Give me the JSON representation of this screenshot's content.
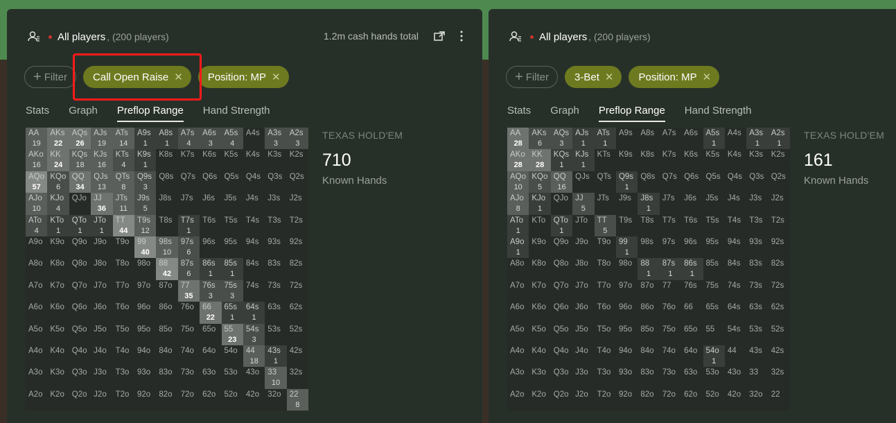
{
  "panels": [
    {
      "header": {
        "label": "All players",
        "count": ", (200 players)",
        "total": "1.2m cash hands total"
      },
      "filter_label": "Filter",
      "chips": [
        "Call Open Raise",
        "Position: MP"
      ],
      "tabs": [
        "Stats",
        "Graph",
        "Preflop Range",
        "Hand Strength"
      ],
      "active_tab": 2,
      "game": "TEXAS HOLD'EM",
      "known_count": "710",
      "known_label": "Known Hands",
      "cells": {
        "AA": 19,
        "AKs": 22,
        "AQs": 26,
        "AJs": 19,
        "ATs": 14,
        "A9s": 1,
        "A8s": 1,
        "A7s": 4,
        "A6s": 3,
        "A5s": 4,
        "A3s": 3,
        "A2s": 3,
        "AKo": 16,
        "KK": 24,
        "KQs": 18,
        "KJs": 16,
        "KTs": 4,
        "K9s": 1,
        "AQo": 57,
        "KQo": 6,
        "QQ": 34,
        "QJs": 13,
        "QTs": 8,
        "Q9s": 3,
        "AJo": 10,
        "KJo": 4,
        "JJ": 36,
        "JTs": 11,
        "J9s": 5,
        "ATo": 4,
        "KTo": 1,
        "QTo": 1,
        "JTo": 1,
        "TT": 44,
        "T9s": 12,
        "T7s": 1,
        "99": 40,
        "98s": 10,
        "97s": 6,
        "88": 42,
        "87s": 6,
        "86s": 1,
        "85s": 1,
        "77": 35,
        "76s": 3,
        "75s": 3,
        "66": 22,
        "65s": 1,
        "64s": 1,
        "55": 23,
        "54s": 3,
        "44": 18,
        "43s": 1,
        "33": 10,
        "22": 8
      }
    },
    {
      "header": {
        "label": "All players",
        "count": ", (200 players)",
        "total": ""
      },
      "filter_label": "Filter",
      "chips": [
        "3-Bet",
        "Position: MP"
      ],
      "tabs": [
        "Stats",
        "Graph",
        "Preflop Range",
        "Hand Strength"
      ],
      "active_tab": 2,
      "game": "TEXAS HOLD'EM",
      "known_count": "161",
      "known_label": "Known Hands",
      "cells": {
        "AA": 28,
        "AKs": 6,
        "AQs": 3,
        "AJs": 1,
        "ATs": 1,
        "A5s": 1,
        "A3s": 1,
        "A2s": 1,
        "AKo": 28,
        "KK": 28,
        "KQs": 1,
        "KJs": 1,
        "AQo": 10,
        "KQo": 5,
        "QQ": 16,
        "Q9s": 1,
        "AJo": 8,
        "KJo": 1,
        "JJ": 5,
        "J8s": 1,
        "ATo": 1,
        "QTo": 1,
        "TT": 5,
        "A9o": 1,
        "99": 1,
        "88": 1,
        "87s": 1,
        "86s": 1,
        "54o": 1
      }
    }
  ],
  "colors": {
    "panel": "#273028",
    "chip": "#6e7a1f",
    "accent_top": "#4e8a4f",
    "highlight": "#ff1a1a"
  }
}
